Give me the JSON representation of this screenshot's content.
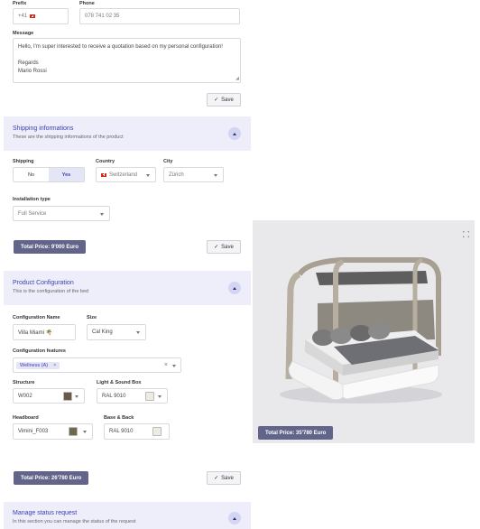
{
  "contact": {
    "prefix_label": "Prefix",
    "prefix_value": "+41",
    "phone_label": "Phone",
    "phone_value": "078 741 02 35",
    "message_label": "Message",
    "message_value": "Hello, I'm super interested to receive a quotation based on my personal configuration!\n\nRegards\nMario Rossi",
    "save_label": "Save"
  },
  "shipping": {
    "title": "Shipping informations",
    "subtitle": "These are the shipping informations of the product",
    "shipping_label": "Shipping",
    "toggle_no": "No",
    "toggle_yes": "Yes",
    "country_label": "Country",
    "country_value": "Switzerland",
    "city_label": "City",
    "city_value": "Zürich",
    "installation_label": "Installation type",
    "installation_value": "Full Service",
    "total_label": "Total  Price: 9'000 Euro",
    "save_label": "Save"
  },
  "preview": {
    "total_label": "Total  Price: 35'780 Euro",
    "expand_icon": "expand-icon"
  },
  "config": {
    "title": "Product Configuration",
    "subtitle": "This is the configuration of the bed",
    "name_label": "Configuration Name",
    "name_value": "Villa Miami 🌴",
    "size_label": "Size",
    "size_value": "Cal King",
    "features_label": "Configuration features",
    "feature_tag": "Wellness (A)",
    "structure_label": "Structure",
    "structure_value": "W002",
    "structure_color": "#6b5a48",
    "lightbox_label": "Light & Sound Box",
    "lightbox_value": "RAL 9010",
    "lightbox_color": "#eeebe2",
    "headboard_label": "Headboard",
    "headboard_value": "Vimini_F003",
    "headboard_color": "#6f6a4c",
    "base_label": "Base & Back",
    "base_value": "RAL 9010",
    "base_color": "#eeebe2",
    "total_label": "Total  Price: 26'780 Euro",
    "save_label": "Save"
  },
  "status": {
    "title": "Manage status request",
    "subtitle": "In this section you can manage the status of the request"
  },
  "colors": {
    "accent": "#3b3fb0",
    "section_bg": "#eeeefb",
    "total_bg": "#62648a",
    "preview_bg": "#e9e9ec"
  }
}
